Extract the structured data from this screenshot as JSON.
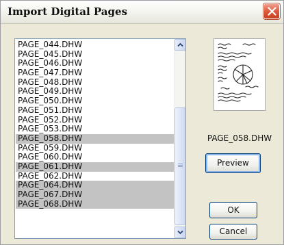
{
  "dialog": {
    "title": "Import Digital Pages"
  },
  "file_list": {
    "items": [
      {
        "name": "PAGE_044.DHW",
        "selected": false
      },
      {
        "name": "PAGE_045.DHW",
        "selected": false
      },
      {
        "name": "PAGE_046.DHW",
        "selected": false
      },
      {
        "name": "PAGE_047.DHW",
        "selected": false
      },
      {
        "name": "PAGE_048.DHW",
        "selected": false
      },
      {
        "name": "PAGE_049.DHW",
        "selected": false
      },
      {
        "name": "PAGE_050.DHW",
        "selected": false
      },
      {
        "name": "PAGE_051.DHW",
        "selected": false
      },
      {
        "name": "PAGE_052.DHW",
        "selected": false
      },
      {
        "name": "PAGE_053.DHW",
        "selected": false
      },
      {
        "name": "PAGE_058.DHW",
        "selected": true
      },
      {
        "name": "PAGE_059.DHW",
        "selected": false
      },
      {
        "name": "PAGE_060.DHW",
        "selected": false
      },
      {
        "name": "PAGE_061.DHW",
        "selected": true
      },
      {
        "name": "PAGE_062.DHW",
        "selected": false
      },
      {
        "name": "PAGE_064.DHW",
        "selected": true
      },
      {
        "name": "PAGE_067.DHW",
        "selected": true
      },
      {
        "name": "PAGE_068.DHW",
        "selected": true
      }
    ]
  },
  "preview": {
    "filename": "PAGE_058.DHW",
    "thumbnail_icon": "handwritten-page-thumbnail"
  },
  "buttons": {
    "preview_label": "Preview",
    "ok_label": "OK",
    "cancel_label": "Cancel"
  },
  "colors": {
    "selection": "#c3c3c3",
    "close_button": "#de5a3c",
    "dialog_background": "#ece9d8"
  }
}
